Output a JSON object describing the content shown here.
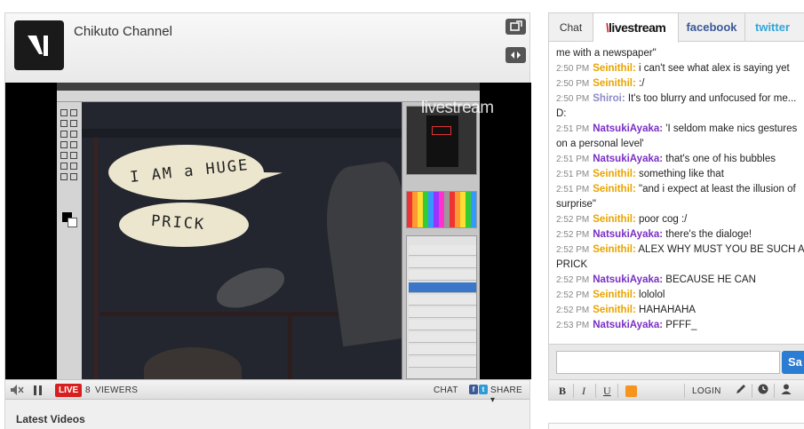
{
  "channel": {
    "title": "Chikuto Channel",
    "controls": {
      "live_label": "LIVE",
      "viewer_count": "8",
      "viewers_label": "VIEWERS",
      "chat_label": "CHAT",
      "share_label": "SHARE ▾",
      "share_fb": "f",
      "share_tw": "t"
    },
    "stream": {
      "watermark": "livestream",
      "bubble1": "I AM a HUGE",
      "bubble2": "PRICK"
    },
    "latest_videos_label": "Latest Videos"
  },
  "chat": {
    "tabs": {
      "chat": "Chat",
      "livestream": "livestream",
      "facebook": "facebook",
      "twitter": "twitter"
    },
    "messages": [
      {
        "time": "",
        "user": "",
        "text": "me with a newspaper\""
      },
      {
        "time": "2:50 PM",
        "user": "Seinithil:",
        "text": "i can't see what alex is saying yet"
      },
      {
        "time": "2:50 PM",
        "user": "Seinithil:",
        "text": ":/"
      },
      {
        "time": "2:50 PM",
        "user": "Shiroi:",
        "text": "It's too blurry and unfocused for me... D:"
      },
      {
        "time": "2:51 PM",
        "user": "NatsukiAyaka:",
        "text": "'I seldom make nics gestures on a personal level'"
      },
      {
        "time": "2:51 PM",
        "user": "NatsukiAyaka:",
        "text": "that's one of his bubbles"
      },
      {
        "time": "2:51 PM",
        "user": "Seinithil:",
        "text": "something like that"
      },
      {
        "time": "2:51 PM",
        "user": "Seinithil:",
        "text": "\"and i expect at least the illusion of surprise\""
      },
      {
        "time": "2:52 PM",
        "user": "Seinithil:",
        "text": "poor cog :/"
      },
      {
        "time": "2:52 PM",
        "user": "NatsukiAyaka:",
        "text": "there's the dialoge!"
      },
      {
        "time": "2:52 PM",
        "user": "Seinithil:",
        "text": "ALEX WHY MUST YOU BE SUCH A PRICK"
      },
      {
        "time": "2:52 PM",
        "user": "NatsukiAyaka:",
        "text": "BECAUSE HE CAN"
      },
      {
        "time": "2:52 PM",
        "user": "Seinithil:",
        "text": "lololol"
      },
      {
        "time": "2:52 PM",
        "user": "Seinithil:",
        "text": "HAHAHAHA"
      },
      {
        "time": "2:53 PM",
        "user": "NatsukiAyaka:",
        "text": "PFFF_"
      }
    ],
    "user_colors": {
      "Seinithil:": "#e8a400",
      "Shiroi:": "#8a8ac8",
      "NatsukiAyaka:": "#7a2fc4"
    },
    "input": {
      "value": "",
      "placeholder": ""
    },
    "say_label": "Sa",
    "toolbar": {
      "bold": "B",
      "italic": "I",
      "underline": "U",
      "login": "LOGIN",
      "text_color": "#f7941d"
    }
  },
  "icons": [
    "popout-icon",
    "expand-icon",
    "mute-icon",
    "pause-icon",
    "pencil-icon",
    "clock-icon",
    "user-icon"
  ]
}
